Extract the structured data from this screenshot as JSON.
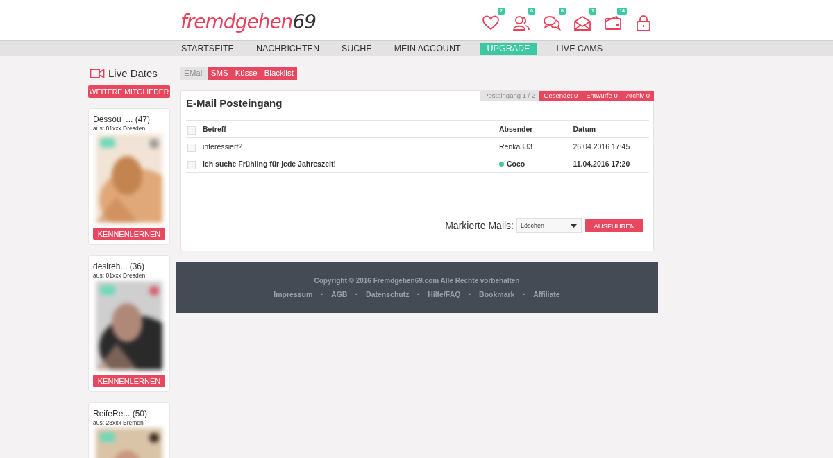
{
  "logo": {
    "word": "fremdgehen",
    "number": "69"
  },
  "header_icons": [
    {
      "kind": "heart",
      "badge": "2"
    },
    {
      "kind": "users",
      "badge": "0"
    },
    {
      "kind": "chat",
      "badge": "0"
    },
    {
      "kind": "mail",
      "badge": "1"
    },
    {
      "kind": "wallet",
      "badge": "14"
    },
    {
      "kind": "lock"
    }
  ],
  "nav": [
    {
      "label": "STARTSEITE",
      "selected": false
    },
    {
      "label": "NACHRICHTEN",
      "selected": false
    },
    {
      "label": "SUCHE",
      "selected": false
    },
    {
      "label": "MEIN ACCOUNT",
      "selected": false
    },
    {
      "label": "UPGRADE",
      "selected": true
    },
    {
      "label": "LIVE CAMS",
      "selected": false
    }
  ],
  "sidebar": {
    "title": "Live Dates",
    "more_button": "WEITERE MITGLIEDER",
    "profiles": [
      {
        "name": "Dessou_... (47)",
        "location": "aus: 01xxx Dresden",
        "button": "KENNENLERNEN"
      },
      {
        "name": "desireh... (36)",
        "location": "aus: 01xxx Dresden",
        "button": "KENNENLERNEN"
      },
      {
        "name": "ReifeRe... (50)",
        "location": "aus: 28xxx Bremen"
      }
    ]
  },
  "message_tabs": [
    {
      "label": "EMail",
      "selected": true
    },
    {
      "label": "SMS",
      "selected": false
    },
    {
      "label": "Küsse",
      "selected": false
    },
    {
      "label": "Blacklist",
      "selected": false
    }
  ],
  "mailbox": {
    "title": "E-Mail Posteingang",
    "folders": [
      {
        "label": "Posteingang 1 / 2",
        "selected": true
      },
      {
        "label": "Gesendet 0",
        "selected": false
      },
      {
        "label": "Entwürfe 0",
        "selected": false
      },
      {
        "label": "Archiv 0",
        "selected": false
      }
    ],
    "select_all_checked": false,
    "columns": [
      "Betreff",
      "Absender",
      "Datum"
    ],
    "rows": [
      {
        "subject": "interessiert?",
        "sender": "Renka333",
        "date": "26.04.2016 17:45",
        "unread": false,
        "online": false,
        "checked": false
      },
      {
        "subject": "Ich suche Frühling für jede Jahreszeit!",
        "sender": "Coco",
        "date": "11.04.2016 17:20",
        "unread": true,
        "online": true,
        "checked": false
      }
    ],
    "bulk_label": "Markierte Mails:",
    "bulk_action": "Löschen",
    "execute_button": "AUSFÜHREN"
  },
  "footer": {
    "copyright": "Copyright © 2016 Fremdgehen69.com Alle Rechte vorbehalten",
    "links": [
      "Impressum",
      "AGB",
      "Datenschutz",
      "Hilfe/FAQ",
      "Bookmark",
      "Affiliate"
    ],
    "separator": "·"
  }
}
